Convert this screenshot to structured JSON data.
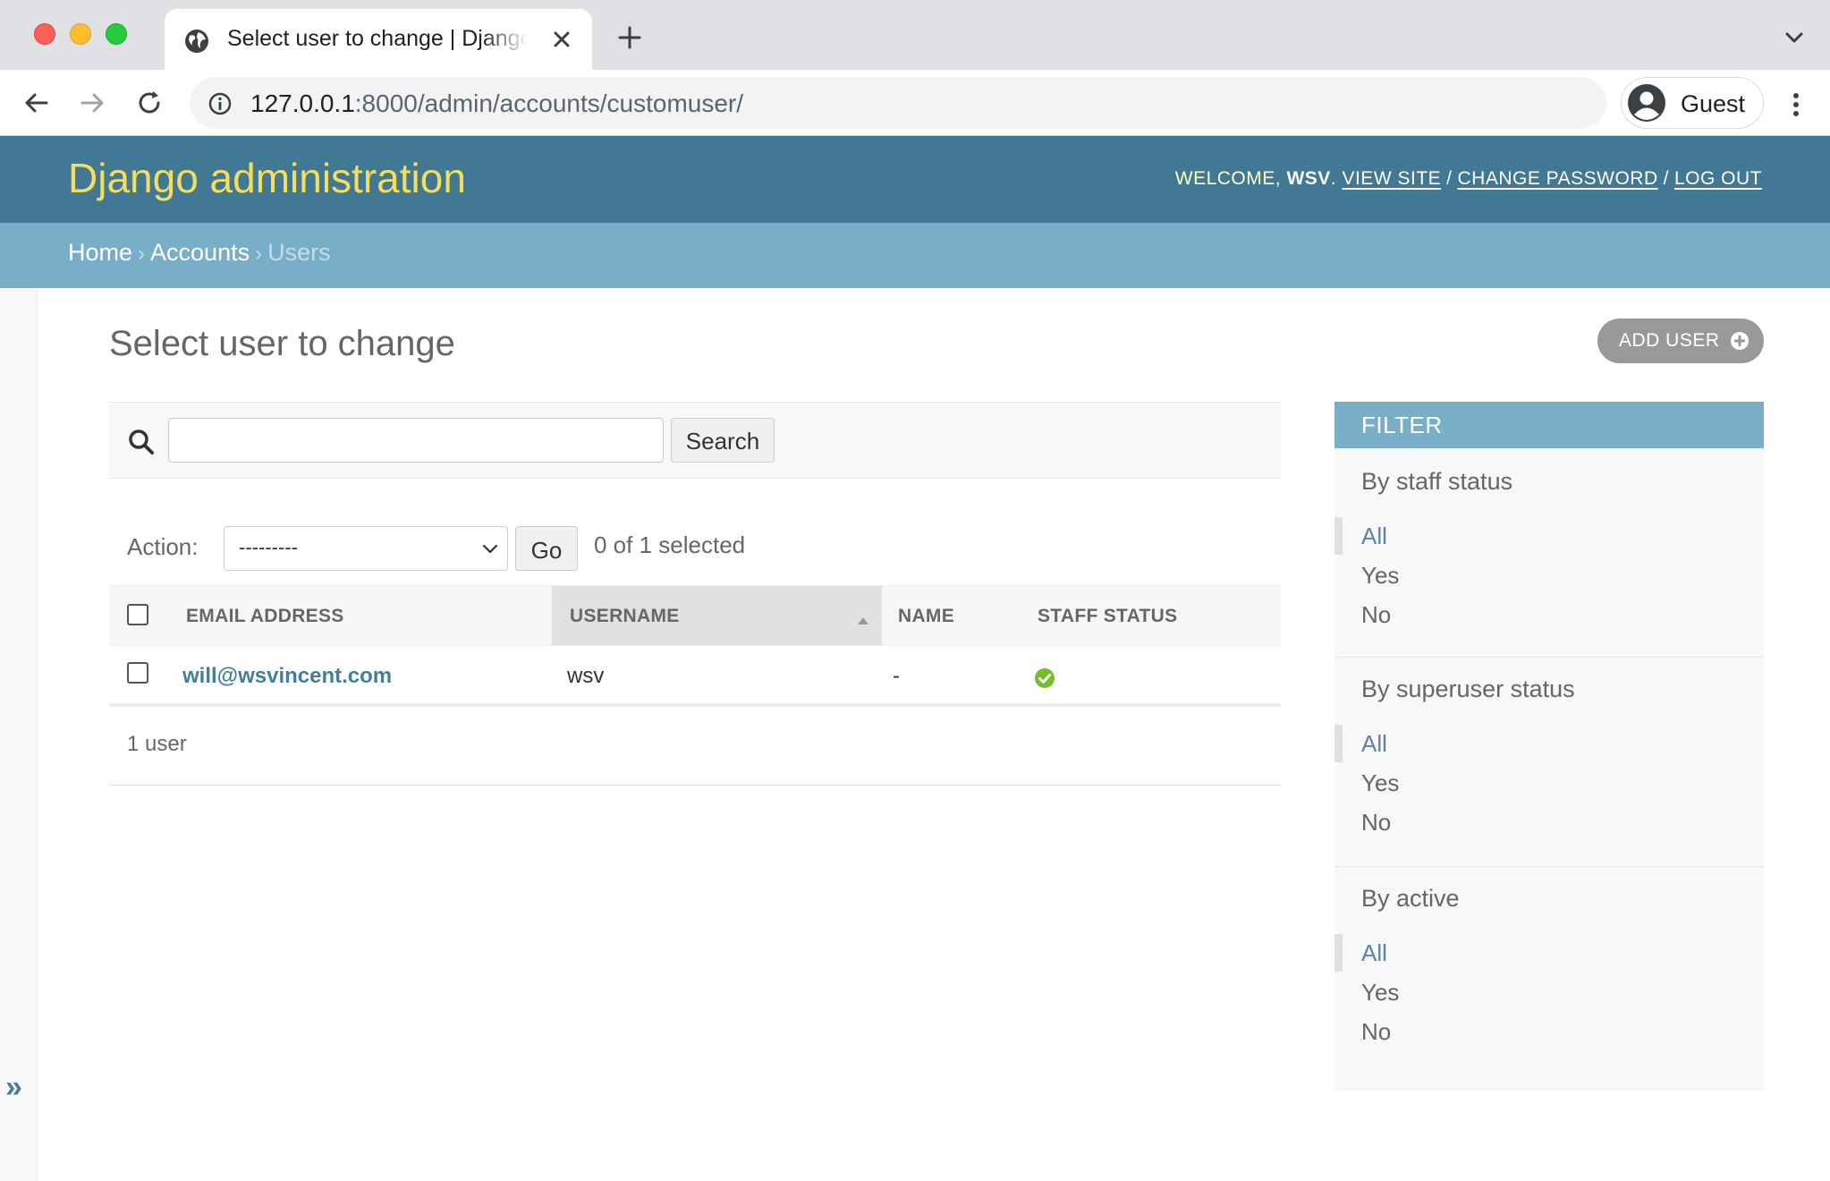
{
  "browser": {
    "tab_title": "Select user to change | Django site admin",
    "url_host": "127.0.0.1",
    "url_rest": ":8000/admin/accounts/customuser/",
    "profile_name": "Guest"
  },
  "header": {
    "branding": "Django administration",
    "welcome": "Welcome, ",
    "username": "wsv",
    "welcome_end": ".",
    "view_site": "View site",
    "change_password": "Change password",
    "log_out": "Log out",
    "sep": "/"
  },
  "breadcrumbs": {
    "home": "Home",
    "accounts": "Accounts",
    "current": "Users",
    "sep": "›"
  },
  "sidebar": {
    "toggle": "»"
  },
  "content": {
    "title": "Select user to change",
    "add_button": "ADD USER"
  },
  "search": {
    "value": "",
    "button": "Search"
  },
  "actions": {
    "label": "Action:",
    "selected_option": "---------",
    "go": "Go",
    "count": "0 of 1 selected"
  },
  "table": {
    "headers": [
      "EMAIL ADDRESS",
      "USERNAME",
      "NAME",
      "STAFF STATUS"
    ],
    "rows": [
      {
        "email": "will@wsvincent.com",
        "username": "wsv",
        "name": "-",
        "staff_status": "yes"
      }
    ]
  },
  "paginator": {
    "text": "1 user"
  },
  "filter": {
    "title": "FILTER",
    "groups": [
      {
        "title": "By staff status",
        "items": [
          "All",
          "Yes",
          "No"
        ]
      },
      {
        "title": "By superuser status",
        "items": [
          "All",
          "Yes",
          "No"
        ]
      },
      {
        "title": "By active",
        "items": [
          "All",
          "Yes",
          "No"
        ]
      }
    ]
  },
  "colors": {
    "header_bg": "#417893",
    "branding": "#f5dd5d",
    "breadcrumbs_bg": "#79aec8",
    "link": "#447e9b",
    "yes_icon": "#70bf2b"
  }
}
